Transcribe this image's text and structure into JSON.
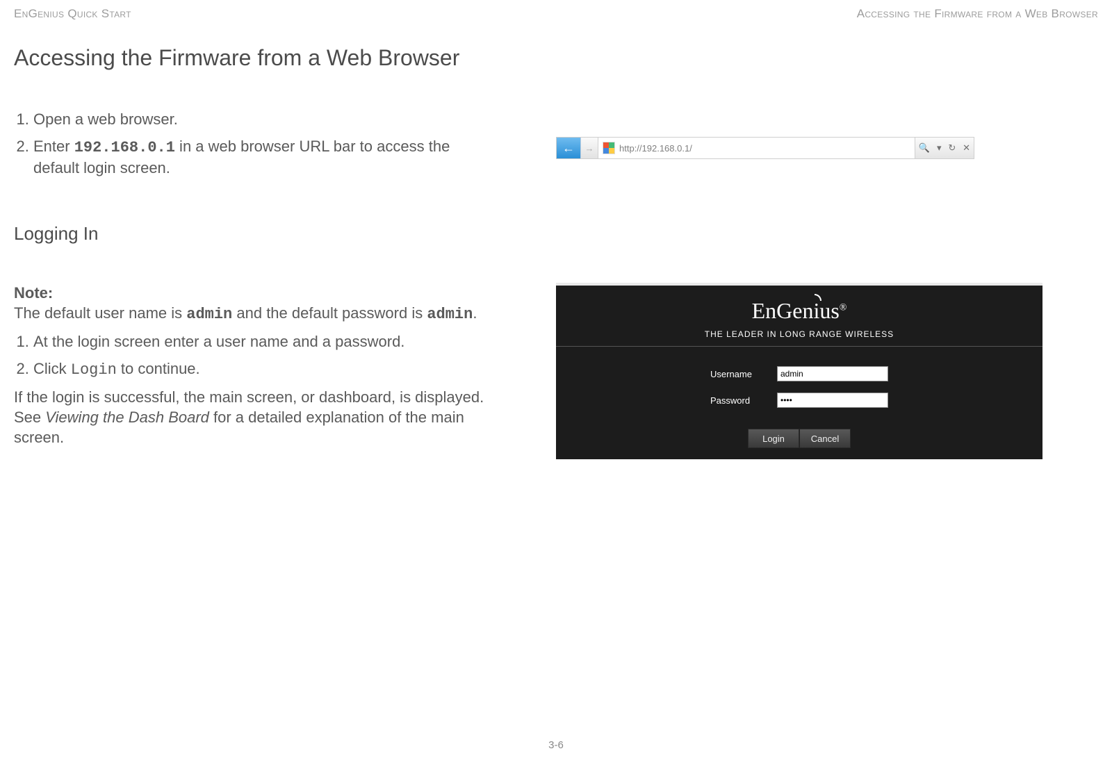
{
  "header": {
    "left": "EnGenius Quick Start",
    "right": "Accessing the Firmware from a Web Browser"
  },
  "heading_main": "Accessing the Firmware from a Web Browser",
  "section1": {
    "step1": "Open a web browser.",
    "step2_pre": "Enter ",
    "step2_code": "192.168.0.1",
    "step2_post": " in a web browser URL bar to access the default login screen."
  },
  "urlbar": {
    "url_text": "http://192.168.0.1/",
    "search_glyph": "🔍",
    "sep": "▾",
    "refresh": "↻",
    "close": "✕"
  },
  "heading_sub": "Logging In",
  "note": {
    "label": "Note:",
    "pre": "The default user name is  ",
    "user": "admin",
    "mid": " and the default password is ",
    "pass": "admin",
    "end": "."
  },
  "section2": {
    "step1": "At the login screen enter a user name and a password.",
    "step2_pre": "Click ",
    "step2_code": "Login",
    "step2_post": " to continue.",
    "para_pre": "If the login is successful, the main screen, or dashboard, is displayed. See ",
    "para_italic": "Viewing the Dash Board",
    "para_post": " for a detailed explanation of the main screen."
  },
  "login": {
    "brand_pre": "EnGen",
    "brand_i": "i",
    "brand_post": "us",
    "brand_reg": "®",
    "tagline": "THE LEADER IN LONG RANGE WIRELESS",
    "username_label": "Username",
    "username_value": "admin",
    "password_label": "Password",
    "password_value": "••••",
    "login_btn": "Login",
    "cancel_btn": "Cancel"
  },
  "page_number": "3-6"
}
